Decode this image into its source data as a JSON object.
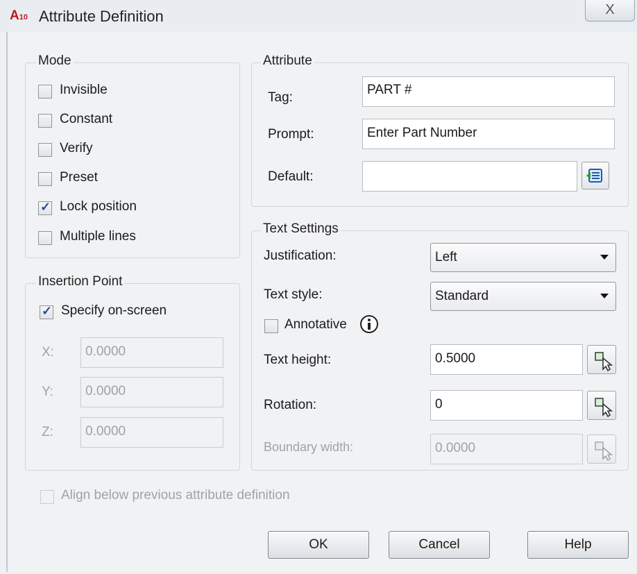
{
  "window": {
    "app_logo": "A",
    "app_version": "10",
    "title": "Attribute Definition",
    "close_label": "X"
  },
  "mode": {
    "label": "Mode",
    "options": [
      {
        "label": "Invisible",
        "checked": false
      },
      {
        "label": "Constant",
        "checked": false
      },
      {
        "label": "Verify",
        "checked": false
      },
      {
        "label": "Preset",
        "checked": false
      },
      {
        "label": "Lock position",
        "checked": true
      },
      {
        "label": "Multiple lines",
        "checked": false
      }
    ]
  },
  "insertion": {
    "label": "Insertion Point",
    "specify_label": "Specify on-screen",
    "specify_checked": true,
    "x_label": "X:",
    "x_value": "0.0000",
    "y_label": "Y:",
    "y_value": "0.0000",
    "z_label": "Z:",
    "z_value": "0.0000"
  },
  "attribute": {
    "label": "Attribute",
    "tag_label": "Tag:",
    "tag_value": "PART #",
    "prompt_label": "Prompt:",
    "prompt_value": "Enter Part Number",
    "default_label": "Default:",
    "default_value": ""
  },
  "text_settings": {
    "label": "Text Settings",
    "justification_label": "Justification:",
    "justification_value": "Left",
    "style_label": "Text style:",
    "style_value": "Standard",
    "annotative_label": "Annotative",
    "annotative_checked": false,
    "height_label": "Text height:",
    "height_value": "0.5000",
    "rotation_label": "Rotation:",
    "rotation_value": "0",
    "boundary_label": "Boundary width:",
    "boundary_value": "0.0000"
  },
  "align_label": "Align below previous attribute definition",
  "buttons": {
    "ok": "OK",
    "cancel": "Cancel",
    "help": "Help"
  }
}
